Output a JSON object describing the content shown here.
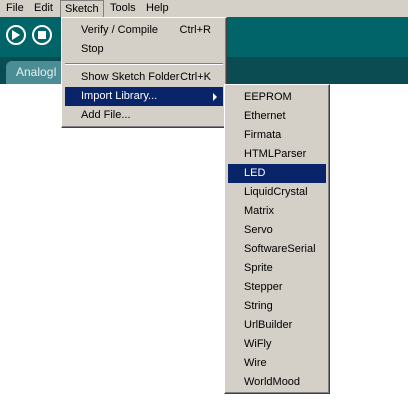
{
  "menubar": {
    "items": [
      {
        "label": "File"
      },
      {
        "label": "Edit"
      },
      {
        "label": "Sketch"
      },
      {
        "label": "Tools"
      },
      {
        "label": "Help"
      }
    ]
  },
  "toolbar": {
    "buttons": [
      {
        "icon": "play-icon"
      },
      {
        "icon": "stop-icon"
      }
    ]
  },
  "tabs": [
    {
      "label": "AnalogI"
    }
  ],
  "sketch_menu": {
    "verify": {
      "label": "Verify / Compile",
      "accel": "Ctrl+R"
    },
    "stop": {
      "label": "Stop"
    },
    "show_folder": {
      "label": "Show Sketch Folder",
      "accel": "Ctrl+K"
    },
    "import_library": {
      "label": "Import Library..."
    },
    "add_file": {
      "label": "Add File..."
    }
  },
  "library_menu": {
    "items": [
      "EEPROM",
      "Ethernet",
      "Firmata",
      "HTMLParser",
      "LED",
      "LiquidCrystal",
      "Matrix",
      "Servo",
      "SoftwareSerial",
      "Sprite",
      "Stepper",
      "String",
      "UrlBuilder",
      "WiFly",
      "Wire",
      "WorldMood"
    ],
    "highlighted": "LED"
  },
  "colors": {
    "menu_bg": "#d4d0c8",
    "highlight": "#0a246a",
    "toolbar": "#006468",
    "tabstrip": "#0b4b52"
  }
}
